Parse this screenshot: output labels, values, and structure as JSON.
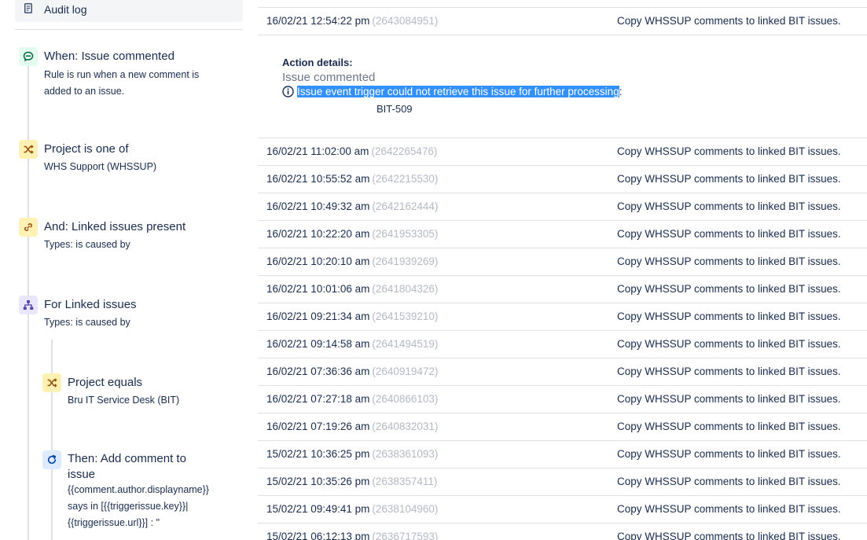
{
  "sidebar": {
    "audit_log_label": "Audit log",
    "components": [
      {
        "title": "When: Issue commented",
        "description": "Rule is run when a new comment is added to an issue.",
        "icon": "comment-trigger-icon",
        "color": "#e3fcef"
      },
      {
        "title": "Project is one of",
        "description": "WHS Support (WHSSUP)",
        "icon": "shuffle-condition-icon",
        "color": "#fff0b3"
      },
      {
        "title": "And: Linked issues present",
        "description": "Types: is caused by",
        "icon": "link-icon",
        "color": "#fff0b3"
      },
      {
        "title": "For Linked issues",
        "description": "Types: is caused by",
        "icon": "branch-hierarchy-icon",
        "color": "#eae6ff"
      },
      {
        "title": "Project equals",
        "description": "Bru IT Service Desk (BIT)",
        "icon": "shuffle-condition-icon",
        "color": "#fff0b3"
      },
      {
        "title": "Then: Add comment to issue",
        "description_lines": [
          "{{comment.author.displayname}}",
          "says in [{{triggerissue.key}}|",
          "{{triggerissue.url}}] : \""
        ],
        "icon": "refresh-action-icon",
        "color": "#deebff"
      }
    ]
  },
  "log": {
    "action_details": {
      "title": "Action details:",
      "subtitle": "Issue commented",
      "message": "Issue event trigger could not retrieve this issue for further processing",
      "message_suffix": ":",
      "issue_key": "BIT-509"
    },
    "rows": [
      {
        "datetime": "16/02/21 12:54:22 pm",
        "id": "(2643084951)",
        "rule": "Copy WHSSUP comments to linked BIT issues."
      },
      {
        "datetime": "16/02/21 11:02:00 am",
        "id": "(2642265476)",
        "rule": "Copy WHSSUP comments to linked BIT issues."
      },
      {
        "datetime": "16/02/21 10:55:52 am",
        "id": "(2642215530)",
        "rule": "Copy WHSSUP comments to linked BIT issues."
      },
      {
        "datetime": "16/02/21 10:49:32 am",
        "id": "(2642162444)",
        "rule": "Copy WHSSUP comments to linked BIT issues."
      },
      {
        "datetime": "16/02/21 10:22:20 am",
        "id": "(2641953305)",
        "rule": "Copy WHSSUP comments to linked BIT issues."
      },
      {
        "datetime": "16/02/21 10:20:10 am",
        "id": "(2641939269)",
        "rule": "Copy WHSSUP comments to linked BIT issues."
      },
      {
        "datetime": "16/02/21 10:01:06 am",
        "id": "(2641804326)",
        "rule": "Copy WHSSUP comments to linked BIT issues."
      },
      {
        "datetime": "16/02/21 09:21:34 am",
        "id": "(2641539210)",
        "rule": "Copy WHSSUP comments to linked BIT issues."
      },
      {
        "datetime": "16/02/21 09:14:58 am",
        "id": "(2641494519)",
        "rule": "Copy WHSSUP comments to linked BIT issues."
      },
      {
        "datetime": "16/02/21 07:36:36 am",
        "id": "(2640919472)",
        "rule": "Copy WHSSUP comments to linked BIT issues."
      },
      {
        "datetime": "16/02/21 07:27:18 am",
        "id": "(2640866103)",
        "rule": "Copy WHSSUP comments to linked BIT issues."
      },
      {
        "datetime": "16/02/21 07:19:26 am",
        "id": "(2640832031)",
        "rule": "Copy WHSSUP comments to linked BIT issues."
      },
      {
        "datetime": "15/02/21 10:36:25 pm",
        "id": "(2638361093)",
        "rule": "Copy WHSSUP comments to linked BIT issues."
      },
      {
        "datetime": "15/02/21 10:35:26 pm",
        "id": "(2638357411)",
        "rule": "Copy WHSSUP comments to linked BIT issues."
      },
      {
        "datetime": "15/02/21 09:49:41 pm",
        "id": "(2638104960)",
        "rule": "Copy WHSSUP comments to linked BIT issues."
      },
      {
        "datetime": "15/02/21 06:12:13 pm",
        "id": "(2636717593)",
        "rule": "Copy WHSSUP comments to linked BIT issues."
      }
    ]
  },
  "colors": {
    "selection": "#3390ff",
    "id_grey": "#b3b9c4",
    "divider": "#dfe1e6",
    "text": "#172b4d"
  }
}
